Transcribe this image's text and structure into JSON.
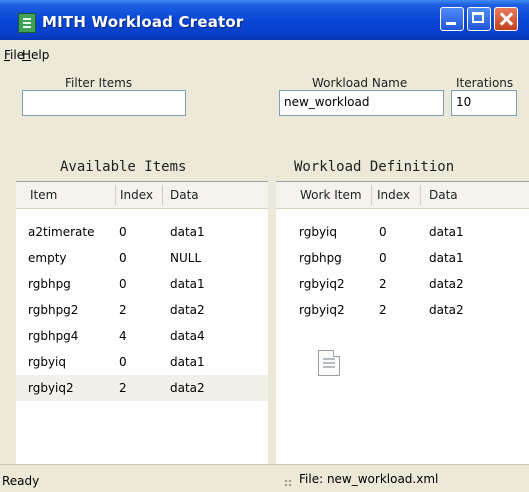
{
  "window": {
    "title": "MITH Workload Creator"
  },
  "menu": {
    "file": "File",
    "file_key": "F",
    "file_rest": "ile",
    "help": "Help",
    "help_key": "H",
    "help_rest": "elp"
  },
  "filter": {
    "label": "Filter Items",
    "value": ""
  },
  "workload": {
    "label": "Workload Name",
    "value": "new_workload"
  },
  "iterations": {
    "label": "Iterations",
    "value": "10"
  },
  "available": {
    "title": "Available Items",
    "columns": [
      "Item",
      "Index",
      "Data"
    ],
    "rows": [
      [
        "a2timerate",
        "0",
        "data1"
      ],
      [
        "empty",
        "0",
        "NULL"
      ],
      [
        "rgbhpg",
        "0",
        "data1"
      ],
      [
        "rgbhpg2",
        "2",
        "data2"
      ],
      [
        "rgbhpg4",
        "4",
        "data4"
      ],
      [
        "rgbyiq",
        "0",
        "data1"
      ],
      [
        "rgbyiq2",
        "2",
        "data2"
      ]
    ],
    "selected_row": 6
  },
  "definition": {
    "title": "Workload Definition",
    "columns": [
      "Work Item",
      "Index",
      "Data"
    ],
    "rows": [
      [
        "rgbyiq",
        "0",
        "data1"
      ],
      [
        "rgbhpg",
        "0",
        "data1"
      ],
      [
        "rgbyiq2",
        "2",
        "data2"
      ],
      [
        "rgbyiq2",
        "2",
        "data2"
      ]
    ]
  },
  "status": {
    "left": "Ready",
    "right": "File: new_workload.xml"
  },
  "icons": {
    "app": "app-icon",
    "file_drop": "document-icon"
  }
}
